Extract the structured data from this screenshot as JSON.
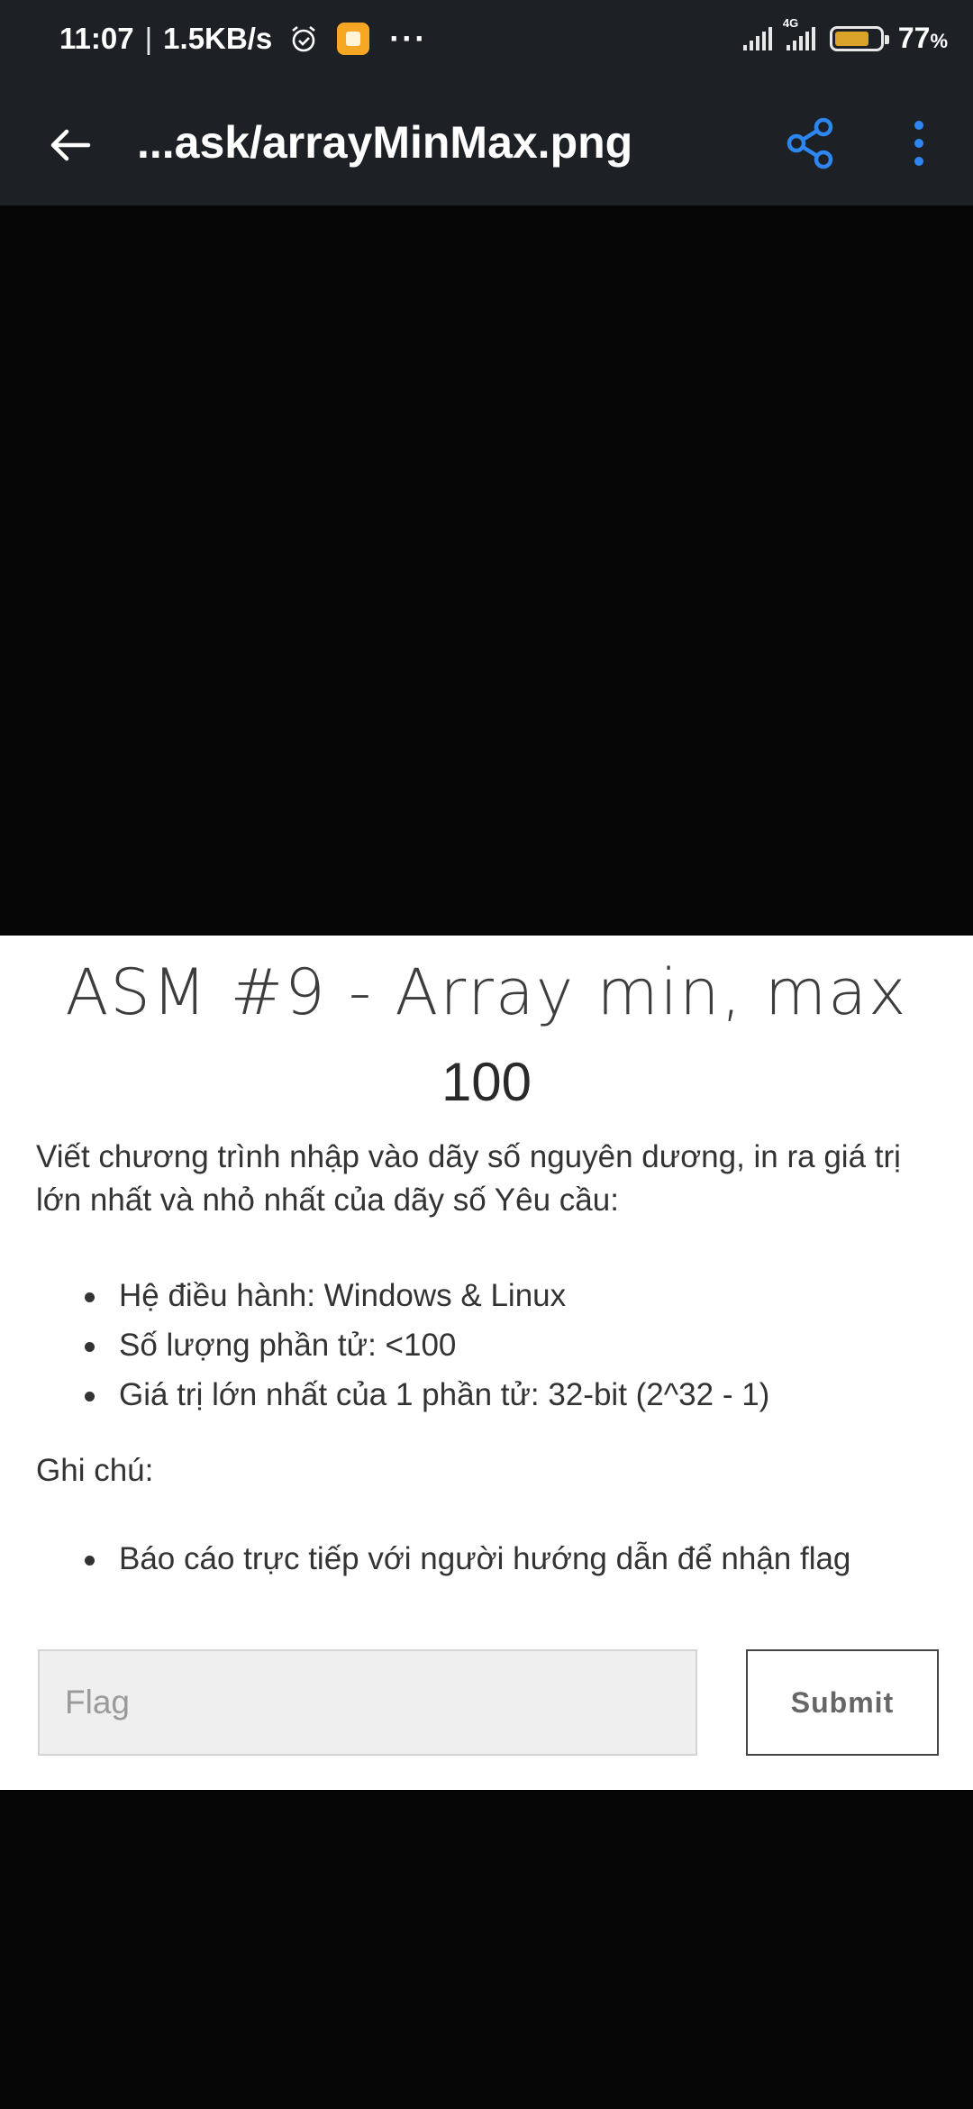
{
  "status_bar": {
    "time": "11:07",
    "speed": "1.5KB/s",
    "network": "4G",
    "battery_percent": "77",
    "battery_unit": "%",
    "battery_level": 0.77,
    "icons": [
      "alarm-icon",
      "note-icon",
      "more-dots-icon",
      "signal-icon",
      "signal-4g-icon",
      "battery-icon"
    ]
  },
  "app_bar": {
    "file_name": "...ask/arrayMinMax.png",
    "icons": [
      "back-arrow-icon",
      "share-icon",
      "more-vertical-icon"
    ],
    "accent_color": "#2e86f0"
  },
  "challenge": {
    "title": "ASM #9 - Array min, max",
    "points": "100",
    "description": "Viết chương trình nhập vào dãy số nguyên dương, in ra giá trị lớn nhất và nhỏ nhất của dãy số Yêu cầu:",
    "requirements": [
      "Hệ điều hành: Windows & Linux",
      "Số lượng phần tử: <100",
      "Giá trị lớn nhất của 1 phần tử: 32-bit (2^32 - 1)"
    ],
    "notes_label": "Ghi chú:",
    "notes": [
      "Báo cáo trực tiếp với người hướng dẫn để nhận flag"
    ]
  },
  "form": {
    "flag_placeholder": "Flag",
    "flag_value": "",
    "submit_label": "Submit"
  }
}
